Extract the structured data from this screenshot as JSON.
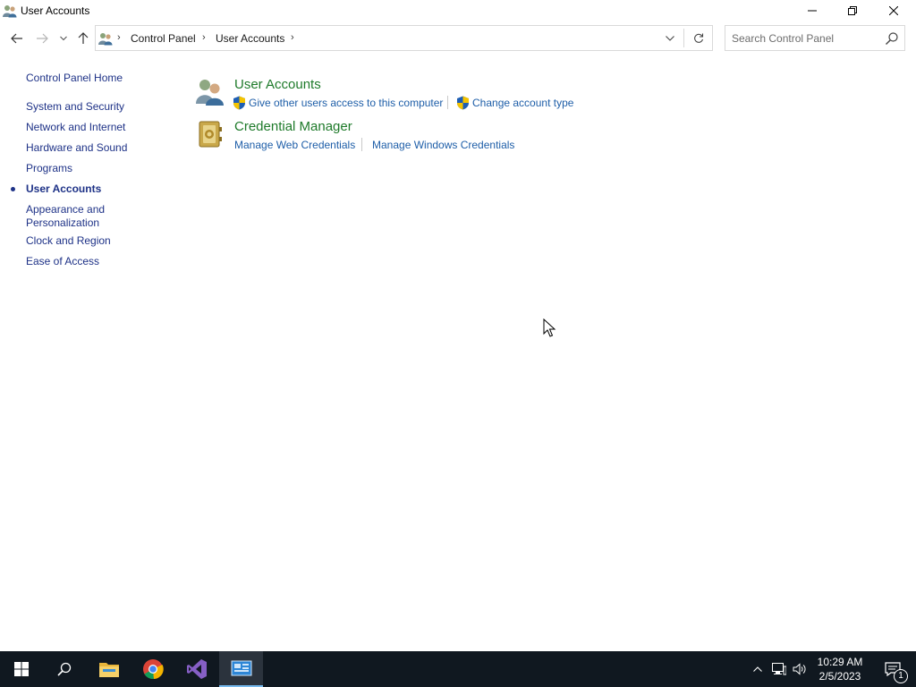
{
  "window": {
    "title": "User Accounts"
  },
  "address": {
    "crumbs": [
      "Control Panel",
      "User Accounts"
    ]
  },
  "search": {
    "placeholder": "Search Control Panel"
  },
  "leftnav": {
    "home": "Control Panel Home",
    "items": [
      "System and Security",
      "Network and Internet",
      "Hardware and Sound",
      "Programs",
      "User Accounts",
      "Appearance and Personalization",
      "Clock and Region",
      "Ease of Access"
    ],
    "appearance_line1": "Appearance and",
    "appearance_line2": "Personalization",
    "selected": "User Accounts"
  },
  "main": {
    "user_accounts": {
      "title": "User Accounts",
      "task1": "Give other users access to this computer",
      "task2": "Change account type"
    },
    "credential_manager": {
      "title": "Credential Manager",
      "task1": "Manage Web Credentials",
      "task2": "Manage Windows Credentials"
    }
  },
  "taskbar": {
    "time": "10:29 AM",
    "date": "2/5/2023",
    "notification_count": "1"
  },
  "colors": {
    "link": "#1e3287",
    "category_title": "#1e7a2a",
    "task_link": "#1e5ea8",
    "taskbar": "#101820"
  }
}
